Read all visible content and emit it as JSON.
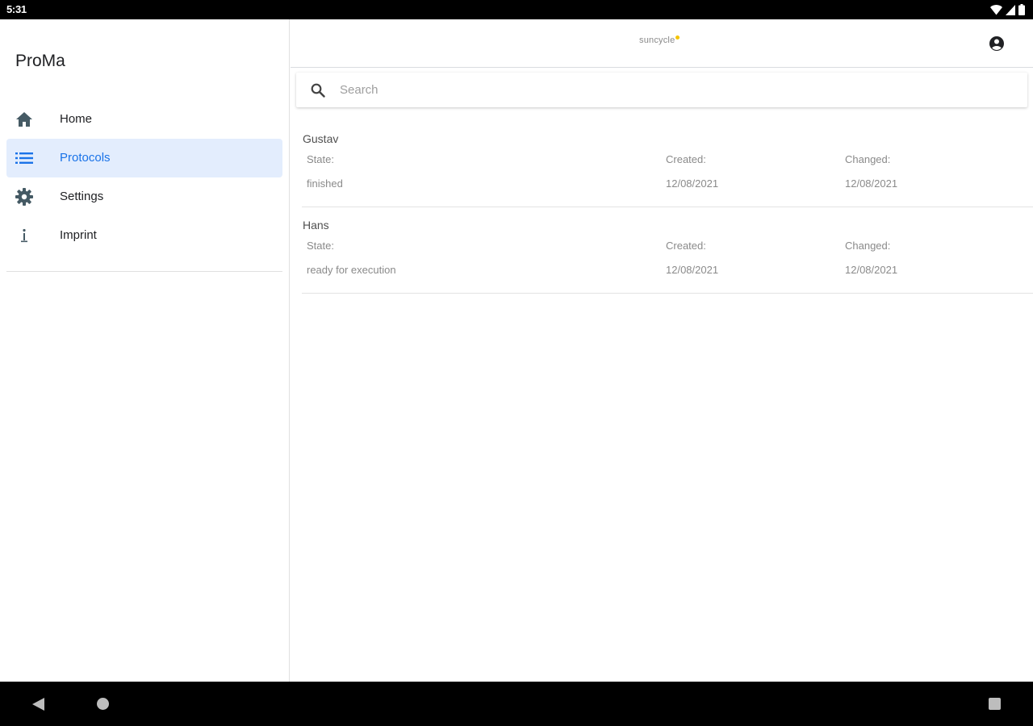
{
  "status_bar": {
    "time": "5:31",
    "icons": [
      "wifi-icon",
      "cellular-signal-icon",
      "battery-icon"
    ]
  },
  "drawer": {
    "title": "ProMa",
    "items": [
      {
        "label": "Home",
        "icon": "home-icon",
        "active": false
      },
      {
        "label": "Protocols",
        "icon": "list-icon",
        "active": true
      },
      {
        "label": "Settings",
        "icon": "gear-icon",
        "active": false
      },
      {
        "label": "Imprint",
        "icon": "info-icon",
        "active": false
      }
    ]
  },
  "appbar": {
    "logo_text": "suncycle",
    "account_icon": "account-circle-icon"
  },
  "search": {
    "placeholder": "Search",
    "value": ""
  },
  "labels": {
    "state": "State:",
    "created": "Created:",
    "changed": "Changed:"
  },
  "protocols": [
    {
      "name": "Gustav",
      "state": "finished",
      "created": "12/08/2021",
      "changed": "12/08/2021"
    },
    {
      "name": "Hans",
      "state": "ready for execution",
      "created": "12/08/2021",
      "changed": "12/08/2021"
    }
  ],
  "colors": {
    "accent": "#1a73e8",
    "active_item_bg": "#e3edfd",
    "logo_dot": "#f5c400",
    "icon_dark": "#455a64"
  },
  "system_nav": {
    "icons": [
      "back-icon",
      "home-circle-icon",
      "recents-icon"
    ]
  }
}
